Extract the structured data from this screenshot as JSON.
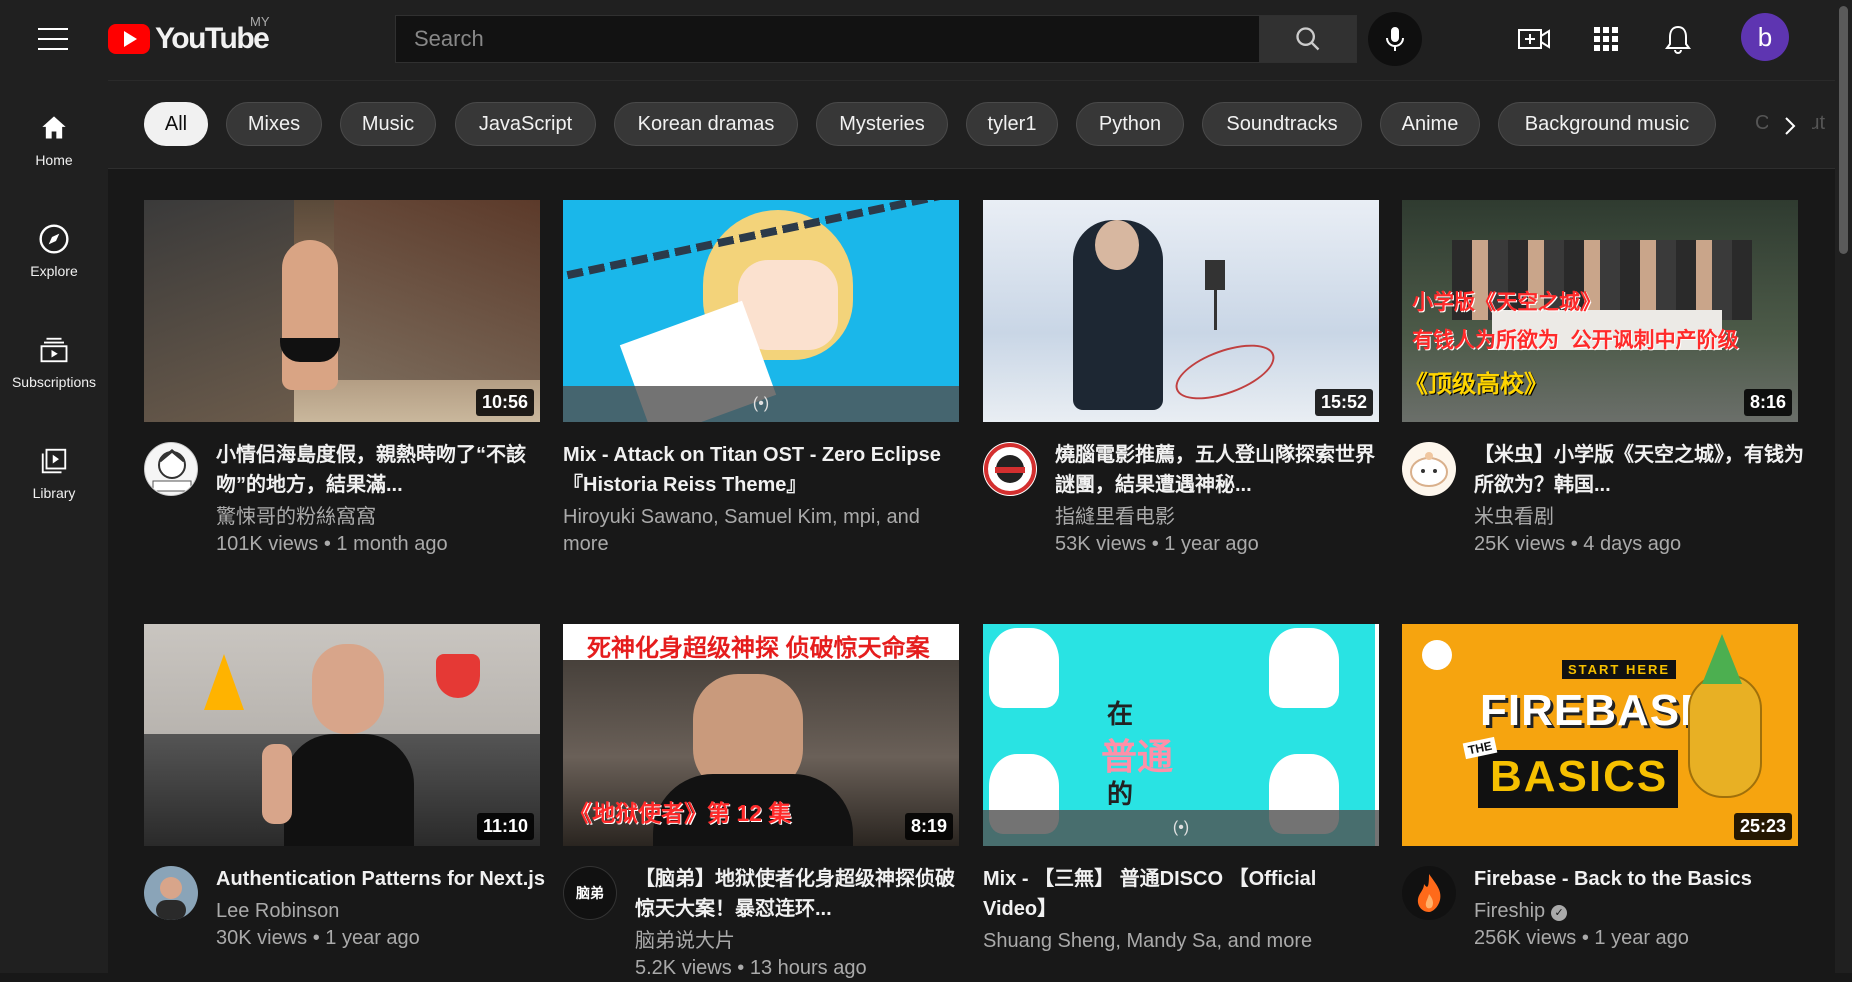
{
  "header": {
    "logo_text": "YouTube",
    "country": "MY",
    "search_placeholder": "Search",
    "avatar_letter": "b"
  },
  "sidebar": {
    "items": [
      {
        "label": "Home",
        "icon": "home-icon"
      },
      {
        "label": "Explore",
        "icon": "compass-icon"
      },
      {
        "label": "Subscriptions",
        "icon": "subscriptions-icon"
      },
      {
        "label": "Library",
        "icon": "library-icon"
      }
    ]
  },
  "chips": [
    "All",
    "Mixes",
    "Music",
    "JavaScript",
    "Korean dramas",
    "Mysteries",
    "tyler1",
    "Python",
    "Soundtracks",
    "Anime",
    "Background music",
    "Comput"
  ],
  "videos": [
    {
      "title": "小情侣海島度假，親熱時吻了“不該吻”的地方，結果滿...",
      "channel": "驚悚哥的粉絲窩窩",
      "stats": "101K views • 1 month ago",
      "duration": "10:56"
    },
    {
      "title": "Mix - Attack on Titan OST - Zero Eclipse『Historia Reiss Theme』",
      "channel": "Hiroyuki Sawano, Samuel Kim, mpi, and more",
      "stats": "",
      "mix_icon": "(•)"
    },
    {
      "title": "燒腦電影推薦，五人登山隊探索世界謎團，結果遭遇神秘...",
      "channel": "指縫里看电影",
      "stats": "53K views • 1 year ago",
      "duration": "15:52"
    },
    {
      "title": "【米虫】小学版《天空之城》，有钱为所欲为？韩国...",
      "channel": "米虫看剧",
      "stats": "25K views • 4 days ago",
      "duration": "8:16",
      "thumb_lines": [
        "小学版《天空之城》",
        "有钱人为所欲为  公开讽刺中产阶级",
        "《顶级高校》"
      ]
    },
    {
      "title": "Authentication Patterns for Next.js",
      "channel": "Lee Robinson",
      "stats": "30K views • 1 year ago",
      "duration": "11:10"
    },
    {
      "title": "【脑弟】地狱使者化身超级神探侦破惊天大案！暴怼连环...",
      "channel": "脑弟说大片",
      "stats": "5.2K views • 13 hours ago",
      "duration": "8:19",
      "thumb_top": "死神化身超级神探 侦破惊天命案",
      "thumb_bottom": "《地狱使者》第 12 集",
      "avatar_text": "脑弟"
    },
    {
      "title": "Mix - 【三無】 普通DISCO 【Official Video】",
      "channel": "Shuang Sheng, Mandy Sa, and more",
      "stats": "",
      "mix_icon": "(•)",
      "thumb_text": [
        "在",
        "普通",
        "的"
      ]
    },
    {
      "title": "Firebase - Back to the Basics",
      "channel": "Fireship",
      "stats": "256K views • 1 year ago",
      "duration": "25:23",
      "thumb_small": "START HERE",
      "thumb_big": "FIREBASE",
      "thumb_the": "THE",
      "thumb_basics": "BASICS"
    }
  ]
}
